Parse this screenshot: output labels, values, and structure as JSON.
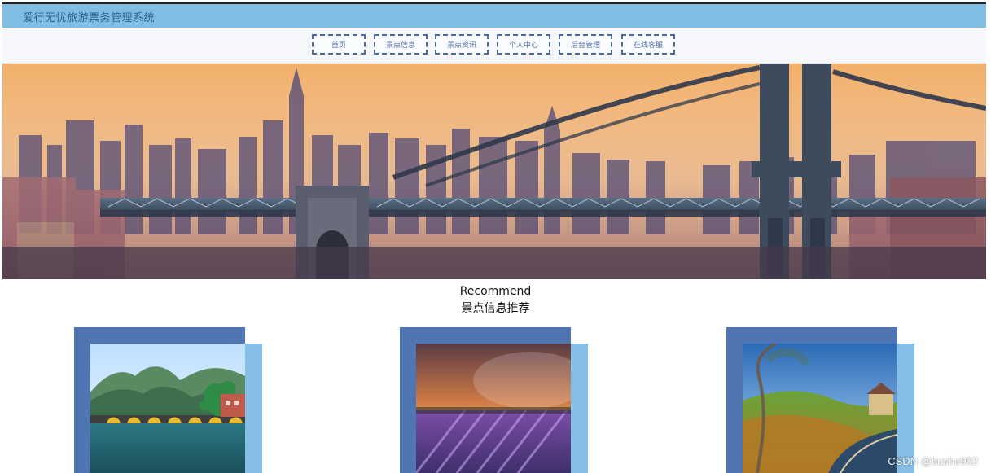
{
  "app": {
    "title": "爱行无忧旅游票务管理系统"
  },
  "nav": {
    "items": [
      {
        "label": "首页"
      },
      {
        "label": "景点信息"
      },
      {
        "label": "景点资讯"
      },
      {
        "label": "个人中心"
      },
      {
        "label": "后台管理"
      },
      {
        "label": "在线客服"
      }
    ]
  },
  "carousel": {
    "slide_count": 3,
    "active_index": 0,
    "icons": {
      "next": "chevron-left-icon"
    }
  },
  "recommend": {
    "title_en": "Recommend",
    "title_cn": "景点信息推荐"
  },
  "watermark": {
    "text": "CSDN @bushe902"
  },
  "colors": {
    "titlebar_bg": "#7fbde3",
    "nav_border": "#4b6aa0",
    "card_dark": "#4f76b2",
    "card_light": "#86bfe6"
  }
}
